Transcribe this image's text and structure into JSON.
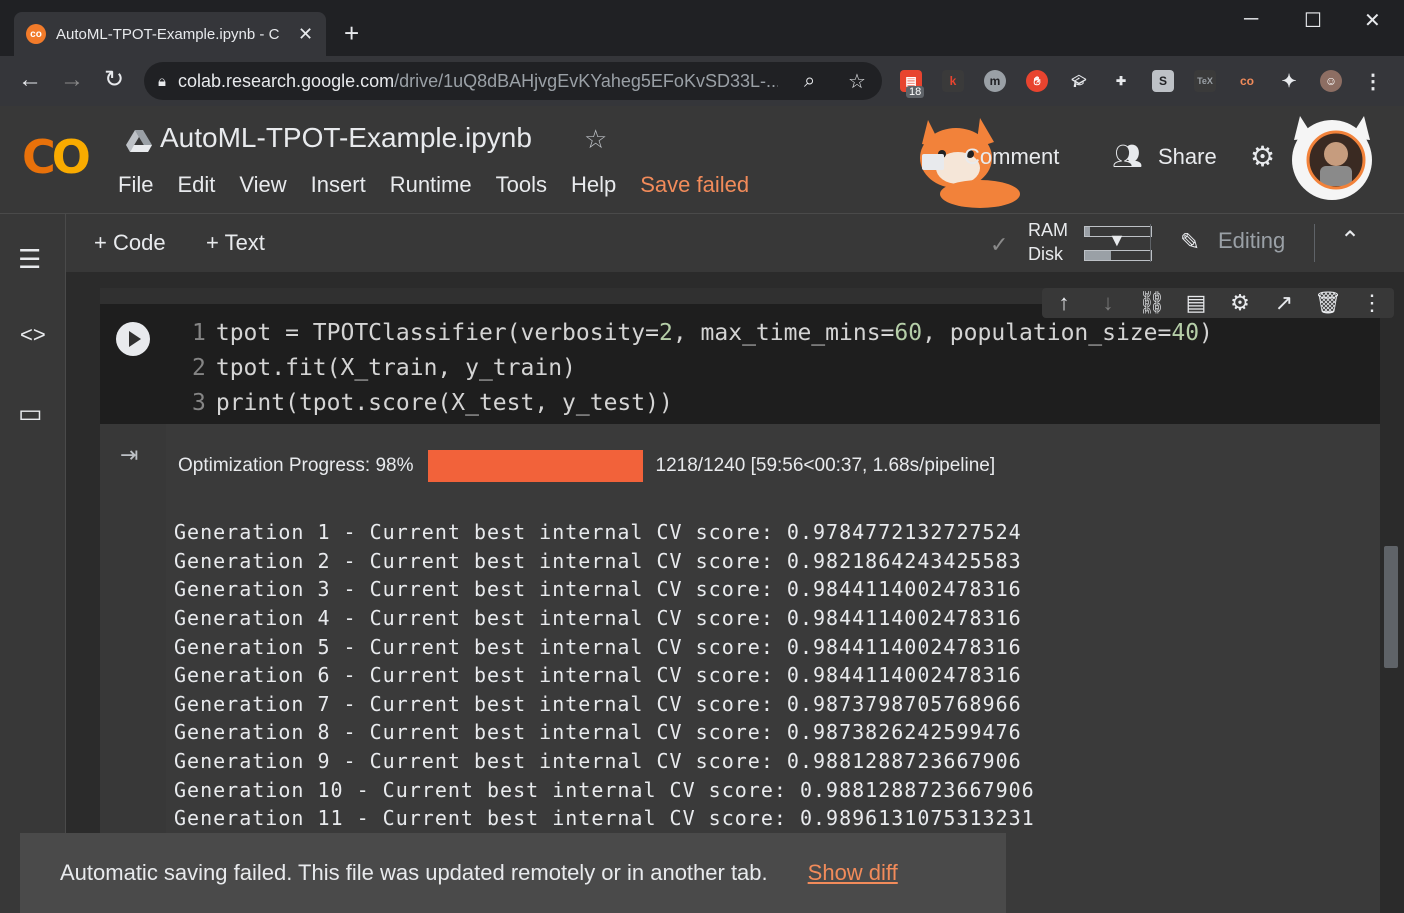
{
  "browser": {
    "tab_title": "AutoML-TPOT-Example.ipynb - C",
    "url_host": "colab.research.google.com",
    "url_path": "/drive/1uQ8dBAHjvgEvKYaheg5EFoKvSD33L-...",
    "extension_badge": "18"
  },
  "colab": {
    "logo_text": "CO",
    "notebook_title": "AutoML-TPOT-Example.ipynb",
    "menu": [
      "File",
      "Edit",
      "View",
      "Insert",
      "Runtime",
      "Tools",
      "Help"
    ],
    "save_status": "Save failed",
    "comment_label": "Comment",
    "share_label": "Share"
  },
  "toolbar": {
    "add_code": "+ Code",
    "add_text": "+ Text",
    "ram_label": "RAM",
    "disk_label": "Disk",
    "ram_usage": 0.08,
    "disk_usage": 0.4,
    "mode_label": "Editing"
  },
  "cell": {
    "code_lines": [
      {
        "n": "1",
        "text": "tpot = TPOTClassifier(verbosity=2, max_time_mins=60, population_size=40)"
      },
      {
        "n": "2",
        "text": "tpot.fit(X_train, y_train)"
      },
      {
        "n": "3",
        "text": "print(tpot.score(X_test, y_test))"
      }
    ],
    "progress_label": "Optimization Progress: 98%",
    "progress_fraction": 0.98,
    "progress_stats": "1218/1240 [59:56<00:37, 1.68s/pipeline]",
    "generations": [
      "Generation 1 - Current best internal CV score: 0.9784772132727524",
      "Generation 2 - Current best internal CV score: 0.9821864243425583",
      "Generation 3 - Current best internal CV score: 0.9844114002478316",
      "Generation 4 - Current best internal CV score: 0.9844114002478316",
      "Generation 5 - Current best internal CV score: 0.9844114002478316",
      "Generation 6 - Current best internal CV score: 0.9844114002478316",
      "Generation 7 - Current best internal CV score: 0.9873798705768966",
      "Generation 8 - Current best internal CV score: 0.9873826242599476",
      "Generation 9 - Current best internal CV score: 0.9881288723667906",
      "Generation 10 - Current best internal CV score: 0.9881288723667906",
      "Generation 11 - Current best internal CV score: 0.9896131075313231"
    ]
  },
  "toast": {
    "message": "Automatic saving failed. This file was updated remotely or in another tab.",
    "action": "Show diff"
  },
  "colors": {
    "accent_orange": "#f28b5a",
    "progress_fill": "#f2623a",
    "colab_logo_yellow": "#f9ab00",
    "colab_logo_orange": "#e8710a"
  }
}
